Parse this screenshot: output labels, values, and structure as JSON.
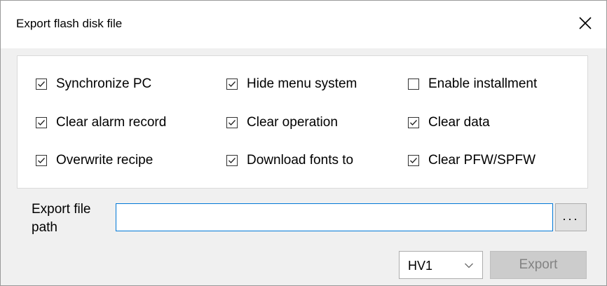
{
  "dialog": {
    "title": "Export flash disk file",
    "close_glyph": "✕"
  },
  "options": [
    {
      "label": "Synchronize PC",
      "checked": true
    },
    {
      "label": "Hide menu system",
      "checked": true
    },
    {
      "label": "Enable installment",
      "checked": false
    },
    {
      "label": "Clear alarm record",
      "checked": true
    },
    {
      "label": "Clear operation",
      "checked": true
    },
    {
      "label": "Clear data",
      "checked": true
    },
    {
      "label": "Overwrite recipe",
      "checked": true
    },
    {
      "label": "Download fonts to",
      "checked": true
    },
    {
      "label": "Clear PFW/SPFW",
      "checked": true
    }
  ],
  "export_path": {
    "label_line1": "Export file",
    "label_line2": "path",
    "value": "",
    "browse_label": "..."
  },
  "device_select": {
    "selected": "HV1"
  },
  "export_button": {
    "label": "Export",
    "enabled": false
  },
  "icons": {
    "close": "close-icon",
    "check": "checkmark-icon",
    "dropdown": "chevron-down-icon"
  },
  "colors": {
    "input_focus_border": "#0078d7",
    "dialog_bg": "#f0f0f0",
    "disabled_button_bg": "#cccccc",
    "disabled_button_text": "#838383"
  }
}
